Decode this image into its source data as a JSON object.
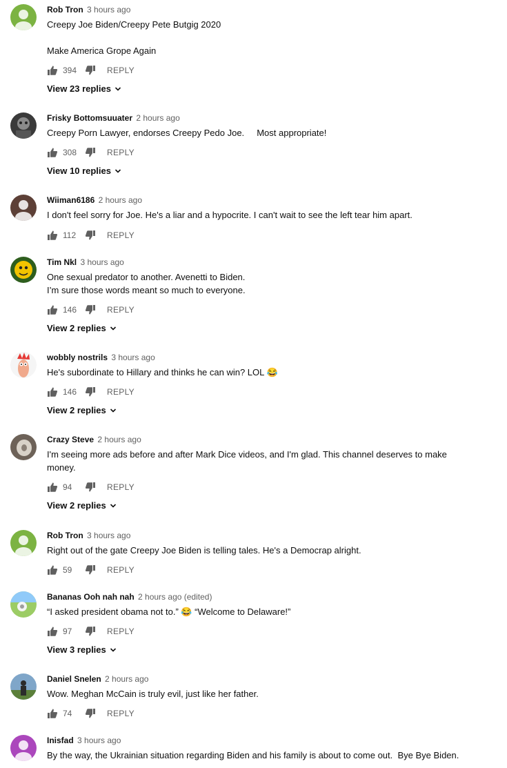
{
  "comments": [
    {
      "author": "Rob Tron",
      "time": "3 hours ago",
      "text": "Creepy Joe Biden/Creepy Pete Butgig 2020\n\nMake America Grope Again",
      "likes": "394",
      "reply": "REPLY",
      "view_replies": "View 23 replies"
    },
    {
      "author": "Frisky Bottomsuuater",
      "time": "2 hours ago",
      "text": "Creepy Porn Lawyer, endorses Creepy Pedo Joe.     Most appropriate!",
      "likes": "308",
      "reply": "REPLY",
      "view_replies": "View 10 replies"
    },
    {
      "author": "Wiiman6186",
      "time": "2 hours ago",
      "text": "I don't feel sorry for Joe. He's a liar and a hypocrite. I can't wait to see the left tear him apart.",
      "likes": "112",
      "reply": "REPLY"
    },
    {
      "author": "Tim Nkl",
      "time": "3 hours ago",
      "text": "One sexual predator to another. Avenetti to Biden.\nI’m sure those words meant so much to everyone.",
      "likes": "146",
      "reply": "REPLY",
      "view_replies": "View 2 replies"
    },
    {
      "author": "wobbly nostrils",
      "time": "3 hours ago",
      "text": "He's subordinate to Hillary and thinks he can win? LOL 😂",
      "likes": "146",
      "reply": "REPLY",
      "view_replies": "View 2 replies"
    },
    {
      "author": "Crazy Steve",
      "time": "2 hours ago",
      "text": "I'm seeing more ads before and after Mark Dice videos, and I'm glad. This channel deserves to make\nmoney.",
      "likes": "94",
      "reply": "REPLY",
      "view_replies": "View 2 replies"
    },
    {
      "author": "Rob Tron",
      "time": "3 hours ago",
      "text": "Right out of the gate Creepy Joe Biden is telling tales. He's a Democrap alright.",
      "likes": "59",
      "reply": "REPLY"
    },
    {
      "author": "Bananas Ooh nah nah",
      "time": "2 hours ago (edited)",
      "text": "“I asked president obama not to.” 😂 “Welcome to Delaware!”",
      "likes": "97",
      "reply": "REPLY",
      "view_replies": "View 3 replies"
    },
    {
      "author": "Daniel Snelen",
      "time": "2 hours ago",
      "text": "Wow. Meghan McCain is truly evil, just like her father.",
      "likes": "74",
      "reply": "REPLY"
    },
    {
      "author": "Inisfad",
      "time": "3 hours ago",
      "text": "By the way, the Ukrainian situation regarding Biden and his family is about to come out.  Bye Bye Biden."
    }
  ],
  "icons": {
    "like": "thumbs-up-icon",
    "dislike": "thumbs-down-icon",
    "chevron": "chevron-down-icon"
  },
  "colors": {
    "avatar_green": "#7cb342",
    "avatar_brown": "#5d4037",
    "avatar_purple": "#ab47bc",
    "secondary_text": "#606060"
  }
}
